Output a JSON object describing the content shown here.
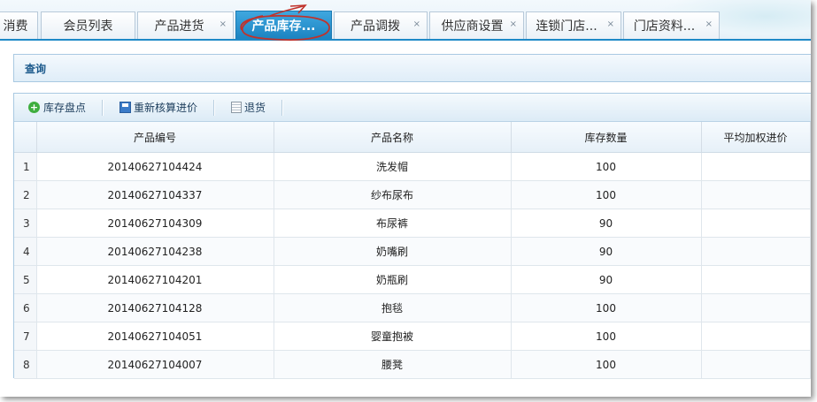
{
  "tabs": [
    {
      "label": "消费",
      "closable": false,
      "active": false
    },
    {
      "label": "会员列表",
      "closable": false,
      "active": false
    },
    {
      "label": "产品进货",
      "closable": true,
      "active": false
    },
    {
      "label": "产品库存...",
      "closable": false,
      "active": true
    },
    {
      "label": "产品调拨",
      "closable": true,
      "active": false
    },
    {
      "label": "供应商设置",
      "closable": true,
      "active": false
    },
    {
      "label": "连锁门店...",
      "closable": true,
      "active": false
    },
    {
      "label": "门店资料...",
      "closable": true,
      "active": false
    }
  ],
  "close_glyph": "×",
  "query": {
    "title": "查询"
  },
  "toolbar": {
    "inventory_check": "库存盘点",
    "recalculate_price": "重新核算进价",
    "return_goods": "退货"
  },
  "table": {
    "columns": [
      "产品编号",
      "产品名称",
      "库存数量",
      "平均加权进价"
    ],
    "rows": [
      {
        "no": "1",
        "code": "20140627104424",
        "name": "洗发帽",
        "qty": "100",
        "avg_price": ""
      },
      {
        "no": "2",
        "code": "20140627104337",
        "name": "纱布尿布",
        "qty": "100",
        "avg_price": ""
      },
      {
        "no": "3",
        "code": "20140627104309",
        "name": "布尿裤",
        "qty": "90",
        "avg_price": ""
      },
      {
        "no": "4",
        "code": "20140627104238",
        "name": "奶嘴刷",
        "qty": "90",
        "avg_price": ""
      },
      {
        "no": "5",
        "code": "20140627104201",
        "name": "奶瓶刷",
        "qty": "90",
        "avg_price": ""
      },
      {
        "no": "6",
        "code": "20140627104128",
        "name": "抱毯",
        "qty": "100",
        "avg_price": ""
      },
      {
        "no": "7",
        "code": "20140627104051",
        "name": "婴童抱被",
        "qty": "100",
        "avg_price": ""
      },
      {
        "no": "8",
        "code": "20140627104007",
        "name": "腰凳",
        "qty": "100",
        "avg_price": ""
      }
    ]
  },
  "colors": {
    "accent": "#1e89c7",
    "annotation": "#c0322b"
  }
}
